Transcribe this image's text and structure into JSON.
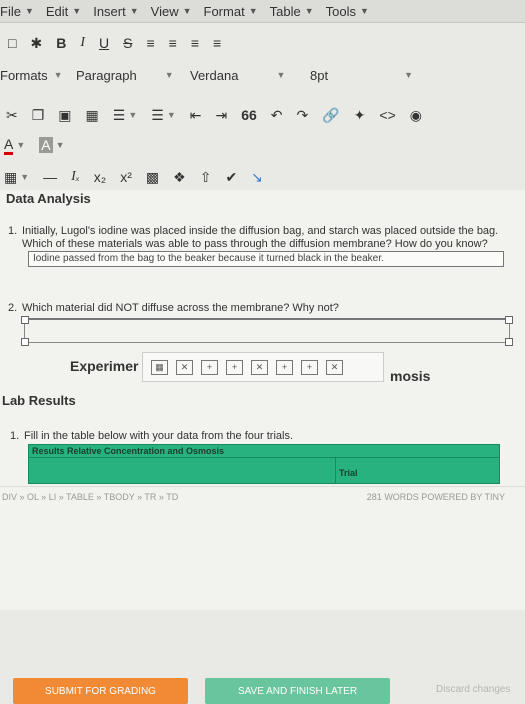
{
  "menubar": {
    "items": [
      {
        "label": "File"
      },
      {
        "label": "Edit"
      },
      {
        "label": "Insert"
      },
      {
        "label": "View"
      },
      {
        "label": "Format"
      },
      {
        "label": "Table"
      },
      {
        "label": "Tools"
      }
    ]
  },
  "toolbar1": {
    "bold": "B",
    "italic": "I",
    "underline": "U",
    "strike": "S"
  },
  "toolbar2": {
    "formats": "Formats",
    "paragraph": "Paragraph",
    "font": "Verdana",
    "size": "8pt"
  },
  "toolbar3": {
    "blockquote": "66",
    "code": "<>"
  },
  "toolbar4": {
    "textcolor": "A",
    "bgcolor": "A"
  },
  "toolbar5": {
    "dash": "—",
    "sub": "x₂",
    "sup": "x²"
  },
  "editor": {
    "section_title": "Data Analysis",
    "q1_number": "1.",
    "q1_text": "Initially, Lugol's iodine was placed inside the diffusion bag, and starch was placed outside the bag. Which of these materials was able to pass through the diffusion membrane? How do you know?",
    "q1_answer": "Iodine passed from the bag to the beaker because it turned black in the beaker.",
    "q2_number": "2.",
    "q2_text": "Which material did NOT diffuse across the membrane? Why not?",
    "heading_left": "Experimer",
    "heading_right": "mosis",
    "lab_results": "Lab Results",
    "fill_number": "1.",
    "fill_text": "Fill in the table below with your data from the four trials.",
    "table_title": "Results Relative Concentration and Osmosis",
    "table_trial": "Trial"
  },
  "statusbar": {
    "path": "DIV » OL » LI » TABLE » TBODY » TR » TD",
    "words": "281 WORDS POWERED BY TINY"
  },
  "actions": {
    "submit": "SUBMIT FOR GRADING",
    "save": "SAVE AND FINISH LATER",
    "discard": "Discard changes"
  }
}
